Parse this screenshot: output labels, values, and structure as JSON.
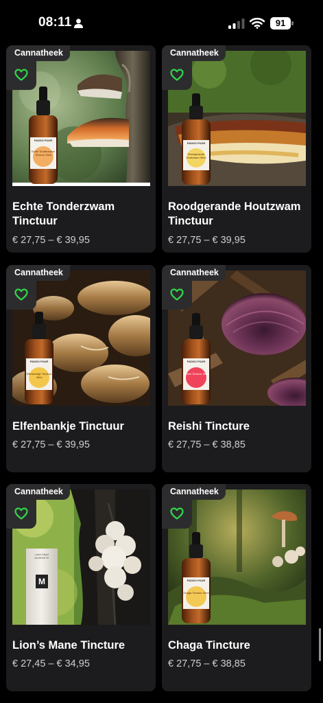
{
  "status_bar": {
    "time": "08:11",
    "battery": "91"
  },
  "products": [
    {
      "brand": "Cannatheek",
      "name": "Echte Tonderzwam Tinctuur",
      "price": "€ 27,75 – € 39,95",
      "bottle_label": "Echte Tonderzwam Tinctuur 30ml"
    },
    {
      "brand": "Cannatheek",
      "name": "Roodgerande Houtzwam Tinctuur",
      "price": "€ 27,75 – € 39,95",
      "bottle_label": "Roodgerande Houtzwam 30ml"
    },
    {
      "brand": "Cannatheek",
      "name": "Elfenbankje Tinctuur",
      "price": "€ 27,75 – € 39,95",
      "bottle_label": "Elfenbankje Tinctuur 30ml"
    },
    {
      "brand": "Cannatheek",
      "name": "Reishi Tincture",
      "price": "€ 27,75 – € 38,85",
      "bottle_label": "Reishi Tincture 30ml"
    },
    {
      "brand": "Cannatheek",
      "name": "Lion’s Mane Tincture",
      "price": "€ 27,45 – € 34,95",
      "bottle_label": "Lions Mane MUSHNITE"
    },
    {
      "brand": "Cannatheek",
      "name": "Chaga Tincture",
      "price": "€ 27,75 – € 38,85",
      "bottle_label": "Chaga Tincture 30ml"
    }
  ],
  "bottle_brand": "PADDO PUUR",
  "colors": {
    "background": "#000000",
    "card": "#1c1c1e",
    "heart": "#32d74b",
    "price": "#cfcfcf"
  }
}
